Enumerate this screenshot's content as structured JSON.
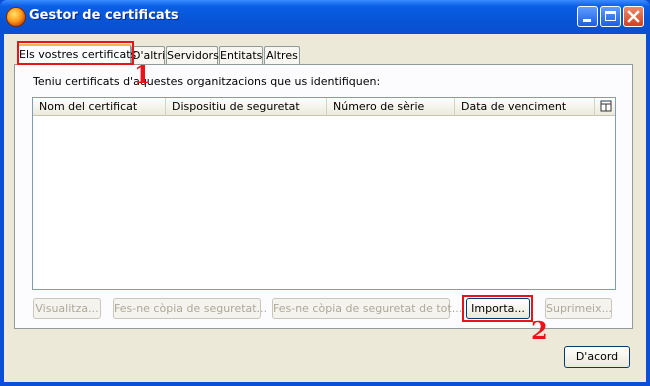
{
  "window": {
    "title": "Gestor de certificats",
    "icon": "firefox-icon"
  },
  "tabs": [
    {
      "label": "Els vostres certificats",
      "active": true
    },
    {
      "label": "D'altri",
      "active": false
    },
    {
      "label": "Servidors",
      "active": false
    },
    {
      "label": "Entitats",
      "active": false
    },
    {
      "label": "Altres",
      "active": false
    }
  ],
  "panel": {
    "info_text": "Teniu certificats d'aquestes organitzacions que us identifiquen:"
  },
  "table": {
    "columns": [
      "Nom del certificat",
      "Dispositiu de seguretat",
      "Número de sèrie",
      "Data de venciment"
    ],
    "rows": []
  },
  "buttons": {
    "view": "Visualitza...",
    "backup": "Fes-ne còpia de seguretat...",
    "backup_all": "Fes-ne còpia de seguretat de tot...",
    "import": "Importa...",
    "delete": "Suprimeix...",
    "ok": "D'acord"
  },
  "annotations": {
    "step1": "1",
    "step2": "2",
    "color": "#e8141a"
  }
}
